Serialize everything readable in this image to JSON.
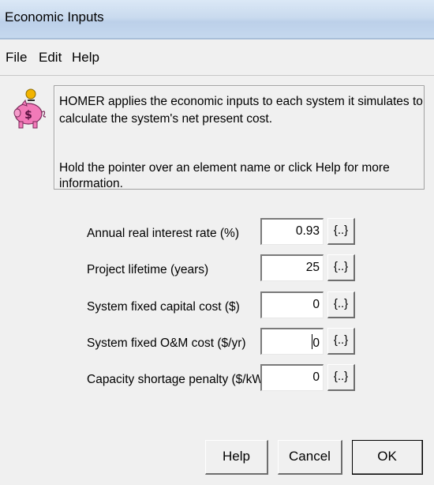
{
  "window": {
    "title": "Economic Inputs"
  },
  "menu": [
    "File",
    "Edit",
    "Help"
  ],
  "info": {
    "line1": "HOMER applies the economic inputs to each system it simulates to",
    "line2": "calculate the system's net present cost.",
    "line3": "Hold the pointer over an element name or click Help for more information."
  },
  "inputs": [
    {
      "label": "Annual real interest rate (%)",
      "value": "0.93",
      "sensitivity": "{..}"
    },
    {
      "label": "Project lifetime (years)",
      "value": "25",
      "sensitivity": "{..}"
    },
    {
      "label": "System fixed capital cost ($)",
      "value": "0",
      "sensitivity": "{..}"
    },
    {
      "label": "System fixed O&M cost ($/yr)",
      "value": "0",
      "sensitivity": "{..}"
    },
    {
      "label": "Capacity shortage penalty ($/kWh)",
      "value": "0",
      "sensitivity": "{..}"
    }
  ],
  "buttons": {
    "help": "Help",
    "cancel": "Cancel",
    "ok": "OK"
  },
  "icon": {
    "name": "piggy-bank-icon",
    "colors": {
      "pig": "#f27ab8",
      "coin": "#f2b400"
    }
  }
}
